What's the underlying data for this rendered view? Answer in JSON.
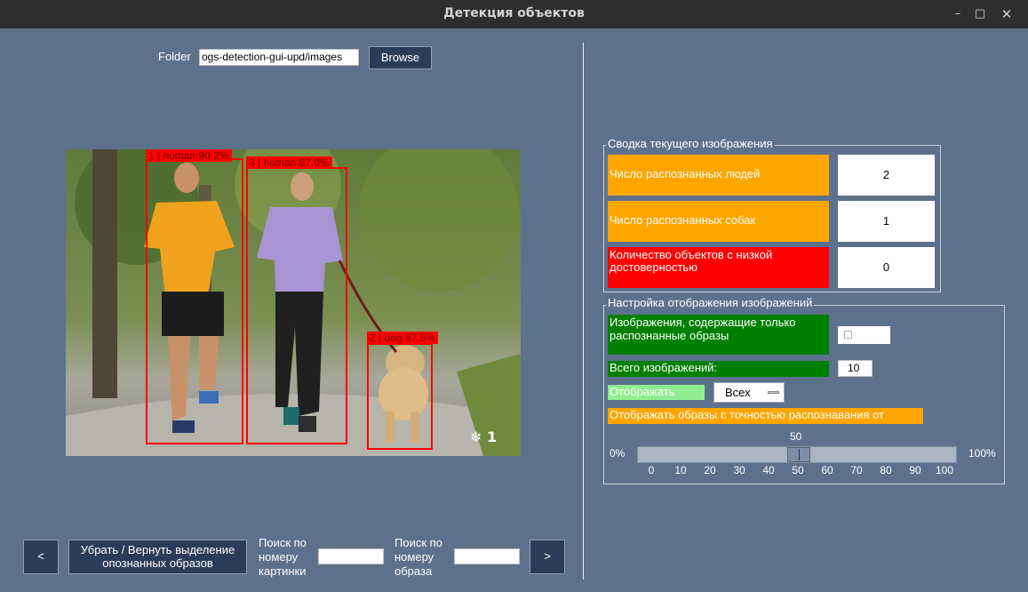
{
  "window": {
    "title": "Детекция объектов",
    "controls": [
      "minimize-icon",
      "maximize-icon",
      "close-icon"
    ]
  },
  "folder": {
    "label": "Folder",
    "path": "ogs-detection-gui-upd/images",
    "browse_label": "Browse"
  },
  "image": {
    "detections": [
      {
        "id": "1",
        "class": "human",
        "confidence": "90.2%"
      },
      {
        "id": "3",
        "class": "human",
        "confidence": "87.0%"
      },
      {
        "id": "2",
        "class": "dog",
        "confidence": "87.5%"
      }
    ],
    "watermark": "1"
  },
  "summary": {
    "title": "Сводка текущего изображения",
    "rows": [
      {
        "label": "Число распознанных людей",
        "value": "2",
        "color": "#ffa500"
      },
      {
        "label": "Число распознанных собак",
        "value": "1",
        "color": "#ffa500"
      },
      {
        "label": "Количество объектов с низкой достоверностью",
        "value": "0",
        "color": "#ff0000"
      }
    ]
  },
  "display_settings": {
    "title": "Настройка отображения изображений",
    "only_recognized_label": "Изображения, содержащие только распознанные образы",
    "only_recognized_checked": false,
    "total_images_label": "Всего изображений:",
    "total_images_value": "10",
    "show_label": "Отображать",
    "show_option": "Всех",
    "threshold_label": "Отображать образы с точностью распознавания от",
    "slider_value": "50",
    "slider_min_label": "0%",
    "slider_max_label": "100%",
    "slider_fraction": 0.5,
    "ticks": [
      "0",
      "10",
      "20",
      "30",
      "40",
      "50",
      "60",
      "70",
      "80",
      "90",
      "100"
    ],
    "colors": {
      "green": "#008000",
      "light_green": "#90ee90",
      "orange": "#ffa500"
    }
  },
  "bottom": {
    "prev_label": "<",
    "next_label": ">",
    "toggle_label": "Убрать / Вернуть выделение опознанных образов",
    "search_image_label": "Поиск по номеру картинки",
    "search_object_label": "Поиск по номеру образа",
    "search_image_value": "",
    "search_object_value": ""
  }
}
